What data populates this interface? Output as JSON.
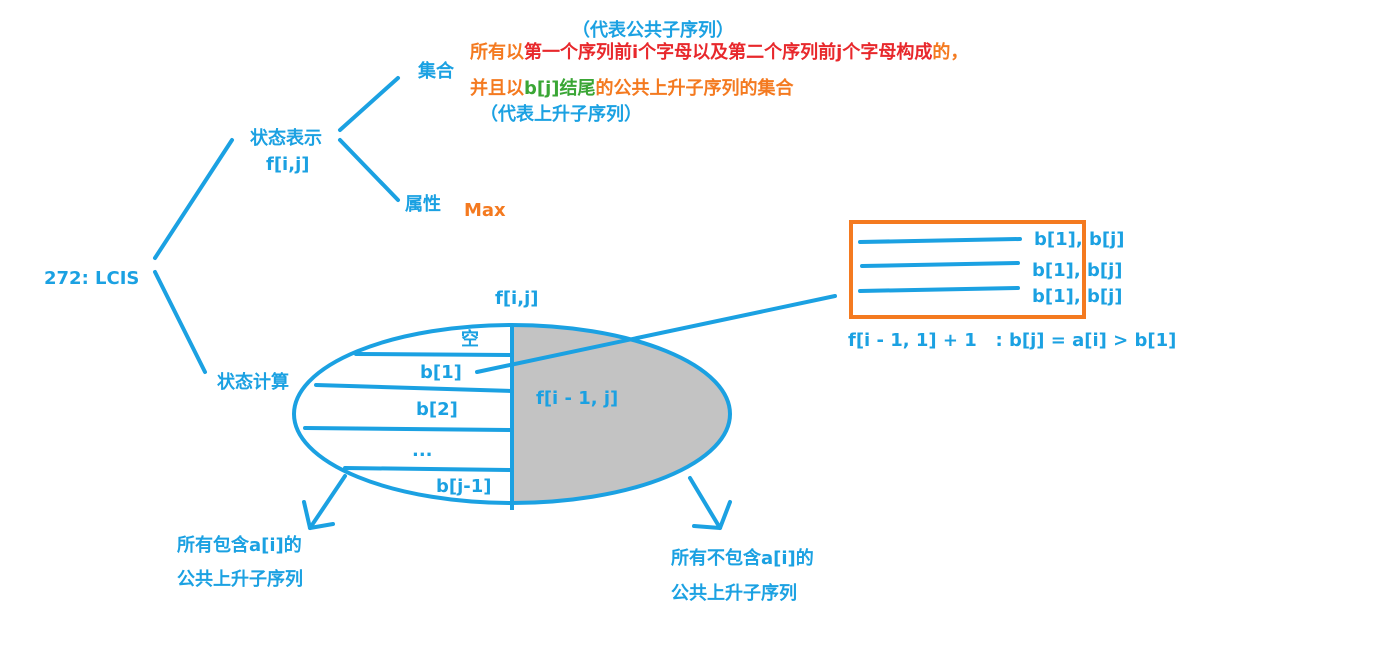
{
  "root": "272: LCIS",
  "state_repr": {
    "label": "状态表示",
    "sub": "f[i,j]"
  },
  "set": {
    "label": "集合",
    "note_top": "（代表公共子序列）",
    "line1_a": "所有以",
    "line1_b": "第一个序列前i个字母以及第二个序列前j个字母构成",
    "line1_c": "的，",
    "line2_a": "并且以",
    "line2_b": "b[j]",
    "line2_c": "结尾",
    "line2_d": "的公共上升子序列的集合",
    "note_bottom": "（代表上升子序列）"
  },
  "attr": {
    "label": "属性",
    "value": "Max"
  },
  "state_calc": {
    "label": "状态计算"
  },
  "ellipse": {
    "top_label": "f[i,j]",
    "rows": [
      "空",
      "b[1]",
      "b[2]",
      "...",
      "b[j-1]"
    ],
    "right_label": "f[i - 1, j]"
  },
  "left_out": {
    "line1": "所有包含a[i]的",
    "line2": "公共上升子序列"
  },
  "right_out": {
    "line1": "所有不包含a[i]的",
    "line2": "公共上升子序列"
  },
  "box": {
    "rows": [
      "b[1], b[j]",
      "b[1], b[j]",
      "b[1], b[j]"
    ]
  },
  "formula": "f[i - 1, 1] + 1   : b[j] = a[i] > b[1]",
  "colors": {
    "blue": "#1ba1e2",
    "orange": "#f47a20",
    "red": "#e8282c",
    "green": "#3aa635",
    "gray": "#c3c3c3"
  }
}
